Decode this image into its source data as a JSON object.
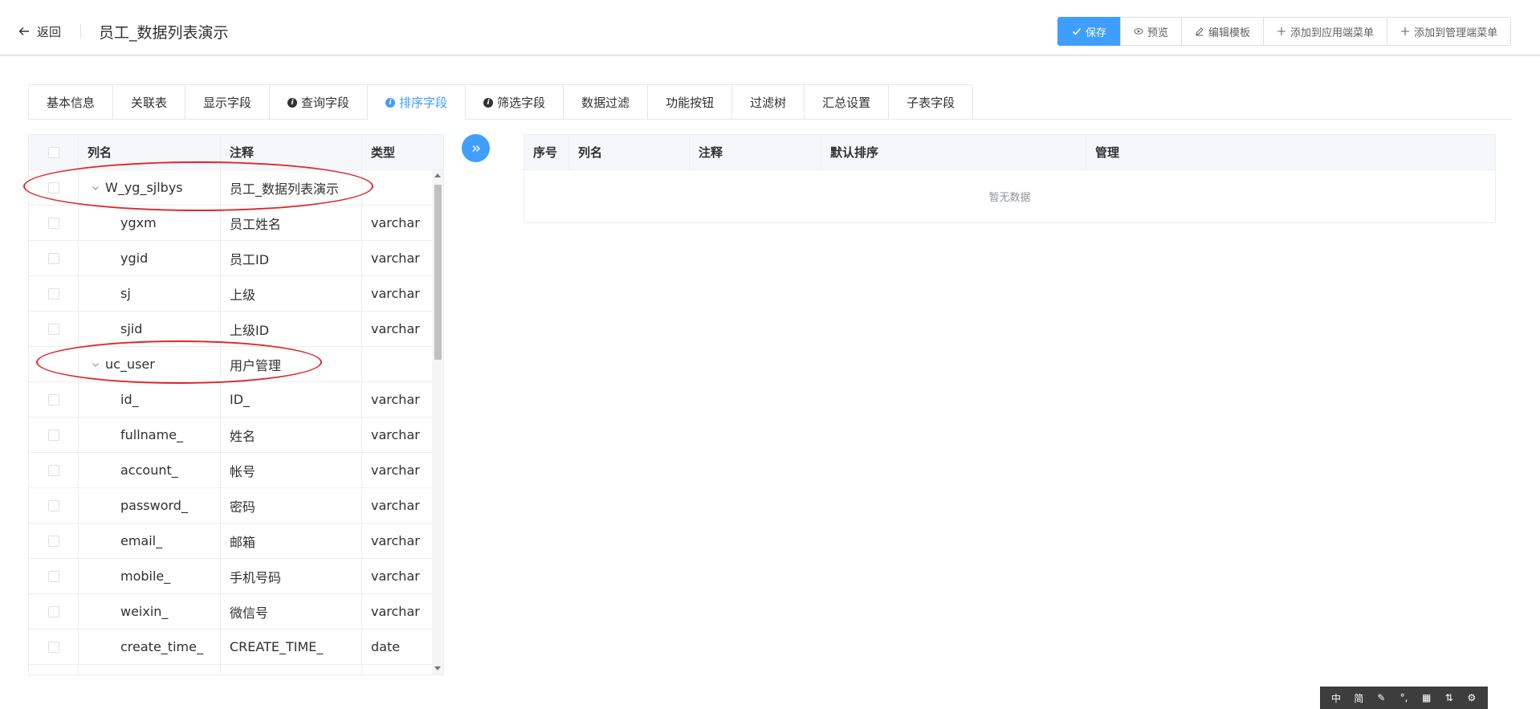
{
  "header": {
    "back_label": "返回",
    "title": "员工_数据列表演示",
    "buttons": {
      "save": "保存",
      "preview": "预览",
      "edit_template": "编辑模板",
      "add_app_menu": "添加到应用端菜单",
      "add_admin_menu": "添加到管理端菜单"
    }
  },
  "tabs": [
    {
      "label": "基本信息"
    },
    {
      "label": "关联表"
    },
    {
      "label": "显示字段"
    },
    {
      "label": "查询字段"
    },
    {
      "label": "排序字段"
    },
    {
      "label": "筛选字段"
    },
    {
      "label": "数据过滤"
    },
    {
      "label": "功能按钮"
    },
    {
      "label": "过滤树"
    },
    {
      "label": "汇总设置"
    },
    {
      "label": "子表字段"
    }
  ],
  "left_table": {
    "headers": {
      "name": "列名",
      "comment": "注释",
      "type": "类型"
    },
    "rows": [
      {
        "name": "W_yg_sjlbys",
        "comment": "员工_数据列表演示",
        "type": ""
      },
      {
        "name": "ygxm",
        "comment": "员工姓名",
        "type": "varchar"
      },
      {
        "name": "ygid",
        "comment": "员工ID",
        "type": "varchar"
      },
      {
        "name": "sj",
        "comment": "上级",
        "type": "varchar"
      },
      {
        "name": "sjid",
        "comment": "上级ID",
        "type": "varchar"
      },
      {
        "name": "uc_user",
        "comment": "用户管理",
        "type": ""
      },
      {
        "name": "id_",
        "comment": "ID_",
        "type": "varchar"
      },
      {
        "name": "fullname_",
        "comment": "姓名",
        "type": "varchar"
      },
      {
        "name": "account_",
        "comment": "帐号",
        "type": "varchar"
      },
      {
        "name": "password_",
        "comment": "密码",
        "type": "varchar"
      },
      {
        "name": "email_",
        "comment": "邮箱",
        "type": "varchar"
      },
      {
        "name": "mobile_",
        "comment": "手机号码",
        "type": "varchar"
      },
      {
        "name": "weixin_",
        "comment": "微信号",
        "type": "varchar"
      },
      {
        "name": "create_time_",
        "comment": "CREATE_TIME_",
        "type": "date"
      }
    ]
  },
  "right_table": {
    "headers": {
      "index": "序号",
      "name": "列名",
      "comment": "注释",
      "default_sort": "默认排序",
      "manage": "管理"
    },
    "empty_text": "暂无数据"
  },
  "ime_bar": [
    "中",
    "简",
    "✎",
    "°,",
    "▦",
    "⇅",
    "⚙"
  ],
  "colors": {
    "primary": "#409eff",
    "annotation": "#e0262b"
  }
}
